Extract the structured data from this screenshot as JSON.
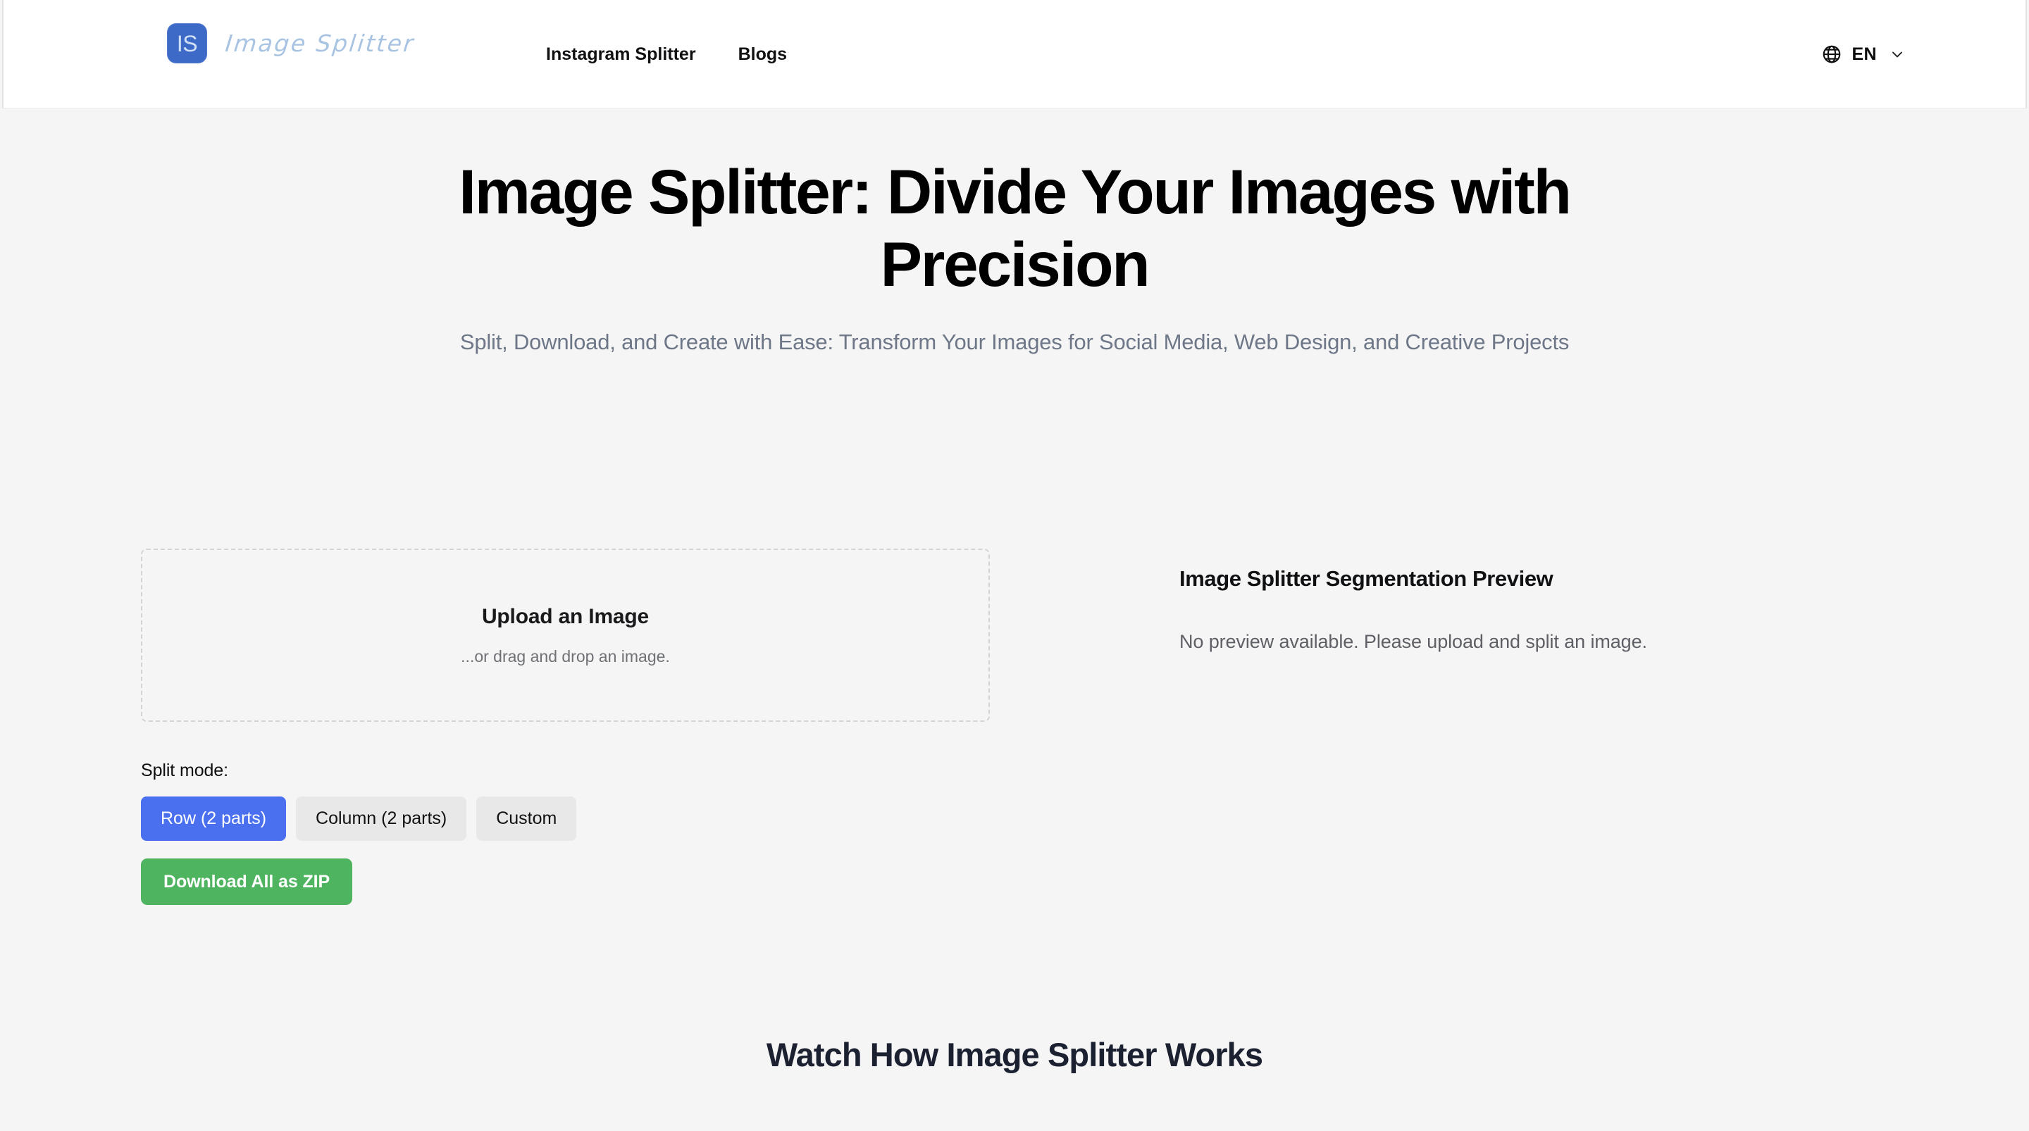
{
  "header": {
    "brand": {
      "mark_text": "IS",
      "wordmark": "Image Splitter",
      "mark_bg": "#3d6ac6",
      "mark_fg": "#cfe0f7",
      "wordmark_color": "#a8c4e2"
    },
    "nav": [
      {
        "label": "Instagram Splitter",
        "name": "nav-link-instagram-splitter"
      },
      {
        "label": "Blogs",
        "name": "nav-link-blogs"
      }
    ],
    "language": {
      "icon": "globe-icon",
      "code": "EN",
      "chevron": "chevron-down-icon"
    }
  },
  "hero": {
    "title": "Image Splitter: Divide Your Images with Precision",
    "subtitle": "Split, Download, and Create with Ease: Transform Your Images for Social Media, Web Design, and Creative Projects"
  },
  "tool": {
    "dropzone": {
      "title": "Upload an Image",
      "hint": "...or drag and drop an image."
    },
    "split_mode": {
      "label": "Split mode:",
      "options": [
        {
          "label": "Row (2 parts)",
          "active": true
        },
        {
          "label": "Column (2 parts)",
          "active": false
        },
        {
          "label": "Custom",
          "active": false
        }
      ],
      "active_color": "#4a70ef",
      "inactive_color": "#e8e8e9"
    },
    "download": {
      "label": "Download All as ZIP",
      "color": "#4fb45f"
    },
    "preview": {
      "title": "Image Splitter Segmentation Preview",
      "empty_message": "No preview available. Please upload and split an image."
    }
  },
  "works": {
    "title": "Watch How Image Splitter Works"
  }
}
